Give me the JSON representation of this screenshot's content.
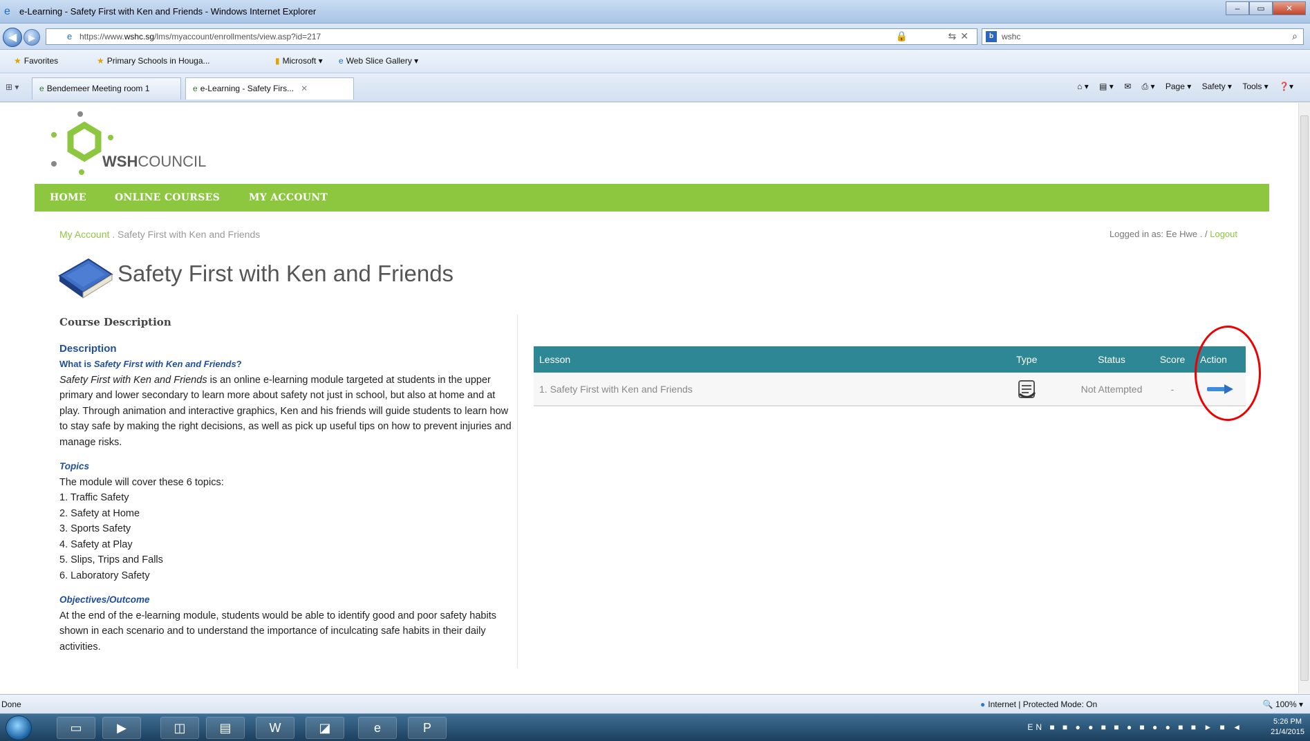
{
  "window": {
    "title": "e-Learning - Safety First with Ken and Friends - Windows Internet Explorer"
  },
  "address": {
    "url_prefix": "https://www.",
    "url_domain": "wshc.sg",
    "url_path": "/lms/myaccount/enrollments/view.asp?id=217",
    "search_value": "wshc"
  },
  "favorites": {
    "label": "Favorites",
    "items": [
      "Primary Schools in Houga...",
      "Microsoft ▾",
      "Web Slice Gallery ▾"
    ]
  },
  "tabs": [
    {
      "label": "Bendemeer Meeting room 1"
    },
    {
      "label": "e-Learning - Safety Firs..."
    }
  ],
  "commandbar": {
    "page": "Page ▾",
    "safety": "Safety ▾",
    "tools": "Tools ▾"
  },
  "site": {
    "logo_bold": "WSH",
    "logo_rest": "COUNCIL",
    "nav": [
      "HOME",
      "ONLINE COURSES",
      "MY ACCOUNT"
    ],
    "breadcrumb": {
      "link": "My Account",
      "separator": ".",
      "current": "Safety First with Ken and Friends"
    },
    "logged_in_prefix": "Logged in as: Ee Hwe .",
    "logged_in_sep": "/",
    "logout": "Logout",
    "page_title": "Safety First with Ken and Friends"
  },
  "description": {
    "section_title": "Course Description",
    "heading": "Description",
    "question_prefix": "What is ",
    "question_title": "Safety First with Ken and Friends",
    "question_suffix": "?",
    "intro_title": "Safety First with Ken and Friends",
    "intro_text": " is an online e-learning module targeted at students in the upper primary and lower secondary to learn more about safety not just in school, but also at home and at play. Through animation and interactive graphics, Ken and his friends will guide students to learn how to stay safe by making the right decisions, as well as pick up useful tips on how to prevent injuries and manage risks.",
    "topics_heading": "Topics",
    "topics_intro": "The module will cover these 6 topics:",
    "topics": [
      "1. Traffic Safety",
      "2. Safety at Home",
      "3. Sports Safety",
      "4. Safety at Play",
      "5. Slips, Trips and Falls",
      "6. Laboratory Safety"
    ],
    "objectives_heading": "Objectives/Outcome",
    "objectives_text": "At the end of the e-learning module, students would be able to identify good and poor safety habits shown in each scenario and to understand the importance of inculcating safe habits in their daily activities."
  },
  "lesson_table": {
    "headers": {
      "lesson": "Lesson",
      "type": "Type",
      "status": "Status",
      "score": "Score",
      "action": "Action"
    },
    "rows": [
      {
        "lesson": "1. Safety First with Ken and Friends",
        "status": "Not Attempted",
        "score": "-"
      }
    ]
  },
  "statusbar": {
    "done": "Done",
    "zone": "Internet | Protected Mode: On",
    "zoom": "100%"
  },
  "taskbar": {
    "lang": "EN",
    "time": "5:26 PM",
    "date": "21/4/2015"
  },
  "colors": {
    "nav_green": "#8dc63f",
    "table_header_teal": "#2e8795",
    "heading_blue": "#1f4e9a",
    "highlight_red": "#e00000"
  }
}
